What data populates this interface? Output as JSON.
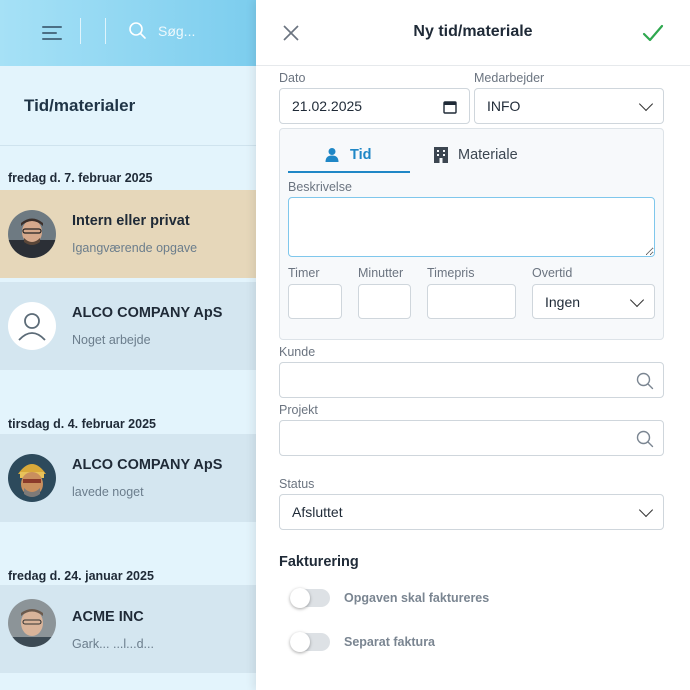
{
  "left": {
    "search": {
      "placeholder": "Søg..."
    },
    "title": "Tid/materialer",
    "groups": [
      {
        "date": "fredag d. 7. februar 2025",
        "entries": [
          {
            "title": "Intern eller privat",
            "subtitle": "Igangværende opgave",
            "bg": "#e6d7ba",
            "avatar": "photo-man-1"
          },
          {
            "title": "ALCO COMPANY ApS",
            "subtitle": "Noget arbejde",
            "bg": "#d4e6f0",
            "avatar": "user-placeholder-icon"
          }
        ]
      },
      {
        "date": "tirsdag d. 4. februar 2025",
        "entries": [
          {
            "title": "ALCO COMPANY ApS",
            "subtitle": "lavede noget",
            "bg": "#d4e6f0",
            "avatar": "cartoon-avatar"
          }
        ]
      },
      {
        "date": "fredag d. 24. januar 2025",
        "entries": [
          {
            "title": "ACME INC",
            "subtitle": "Gark... ...l...d...",
            "bg": "#d4e6f0",
            "avatar": "photo-man-2"
          }
        ]
      }
    ]
  },
  "panel": {
    "title": "Ny tid/materiale",
    "date_label": "Dato",
    "date_value": "21.02.2025",
    "employee_label": "Medarbejder",
    "employee_value": "INFO",
    "tabs": [
      "Tid",
      "Materiale"
    ],
    "description_label": "Beskrivelse",
    "hours_label": "Timer",
    "minutes_label": "Minutter",
    "rate_label": "Timepris",
    "overtime_label": "Overtid",
    "overtime_value": "Ingen",
    "customer_label": "Kunde",
    "project_label": "Projekt",
    "status_label": "Status",
    "status_value": "Afsluttet",
    "billing_title": "Fakturering",
    "toggle_invoice": "Opgaven skal faktureres",
    "toggle_separate": "Separat faktura",
    "accent": "#1f87c6",
    "confirm_color": "#2fa84f"
  }
}
